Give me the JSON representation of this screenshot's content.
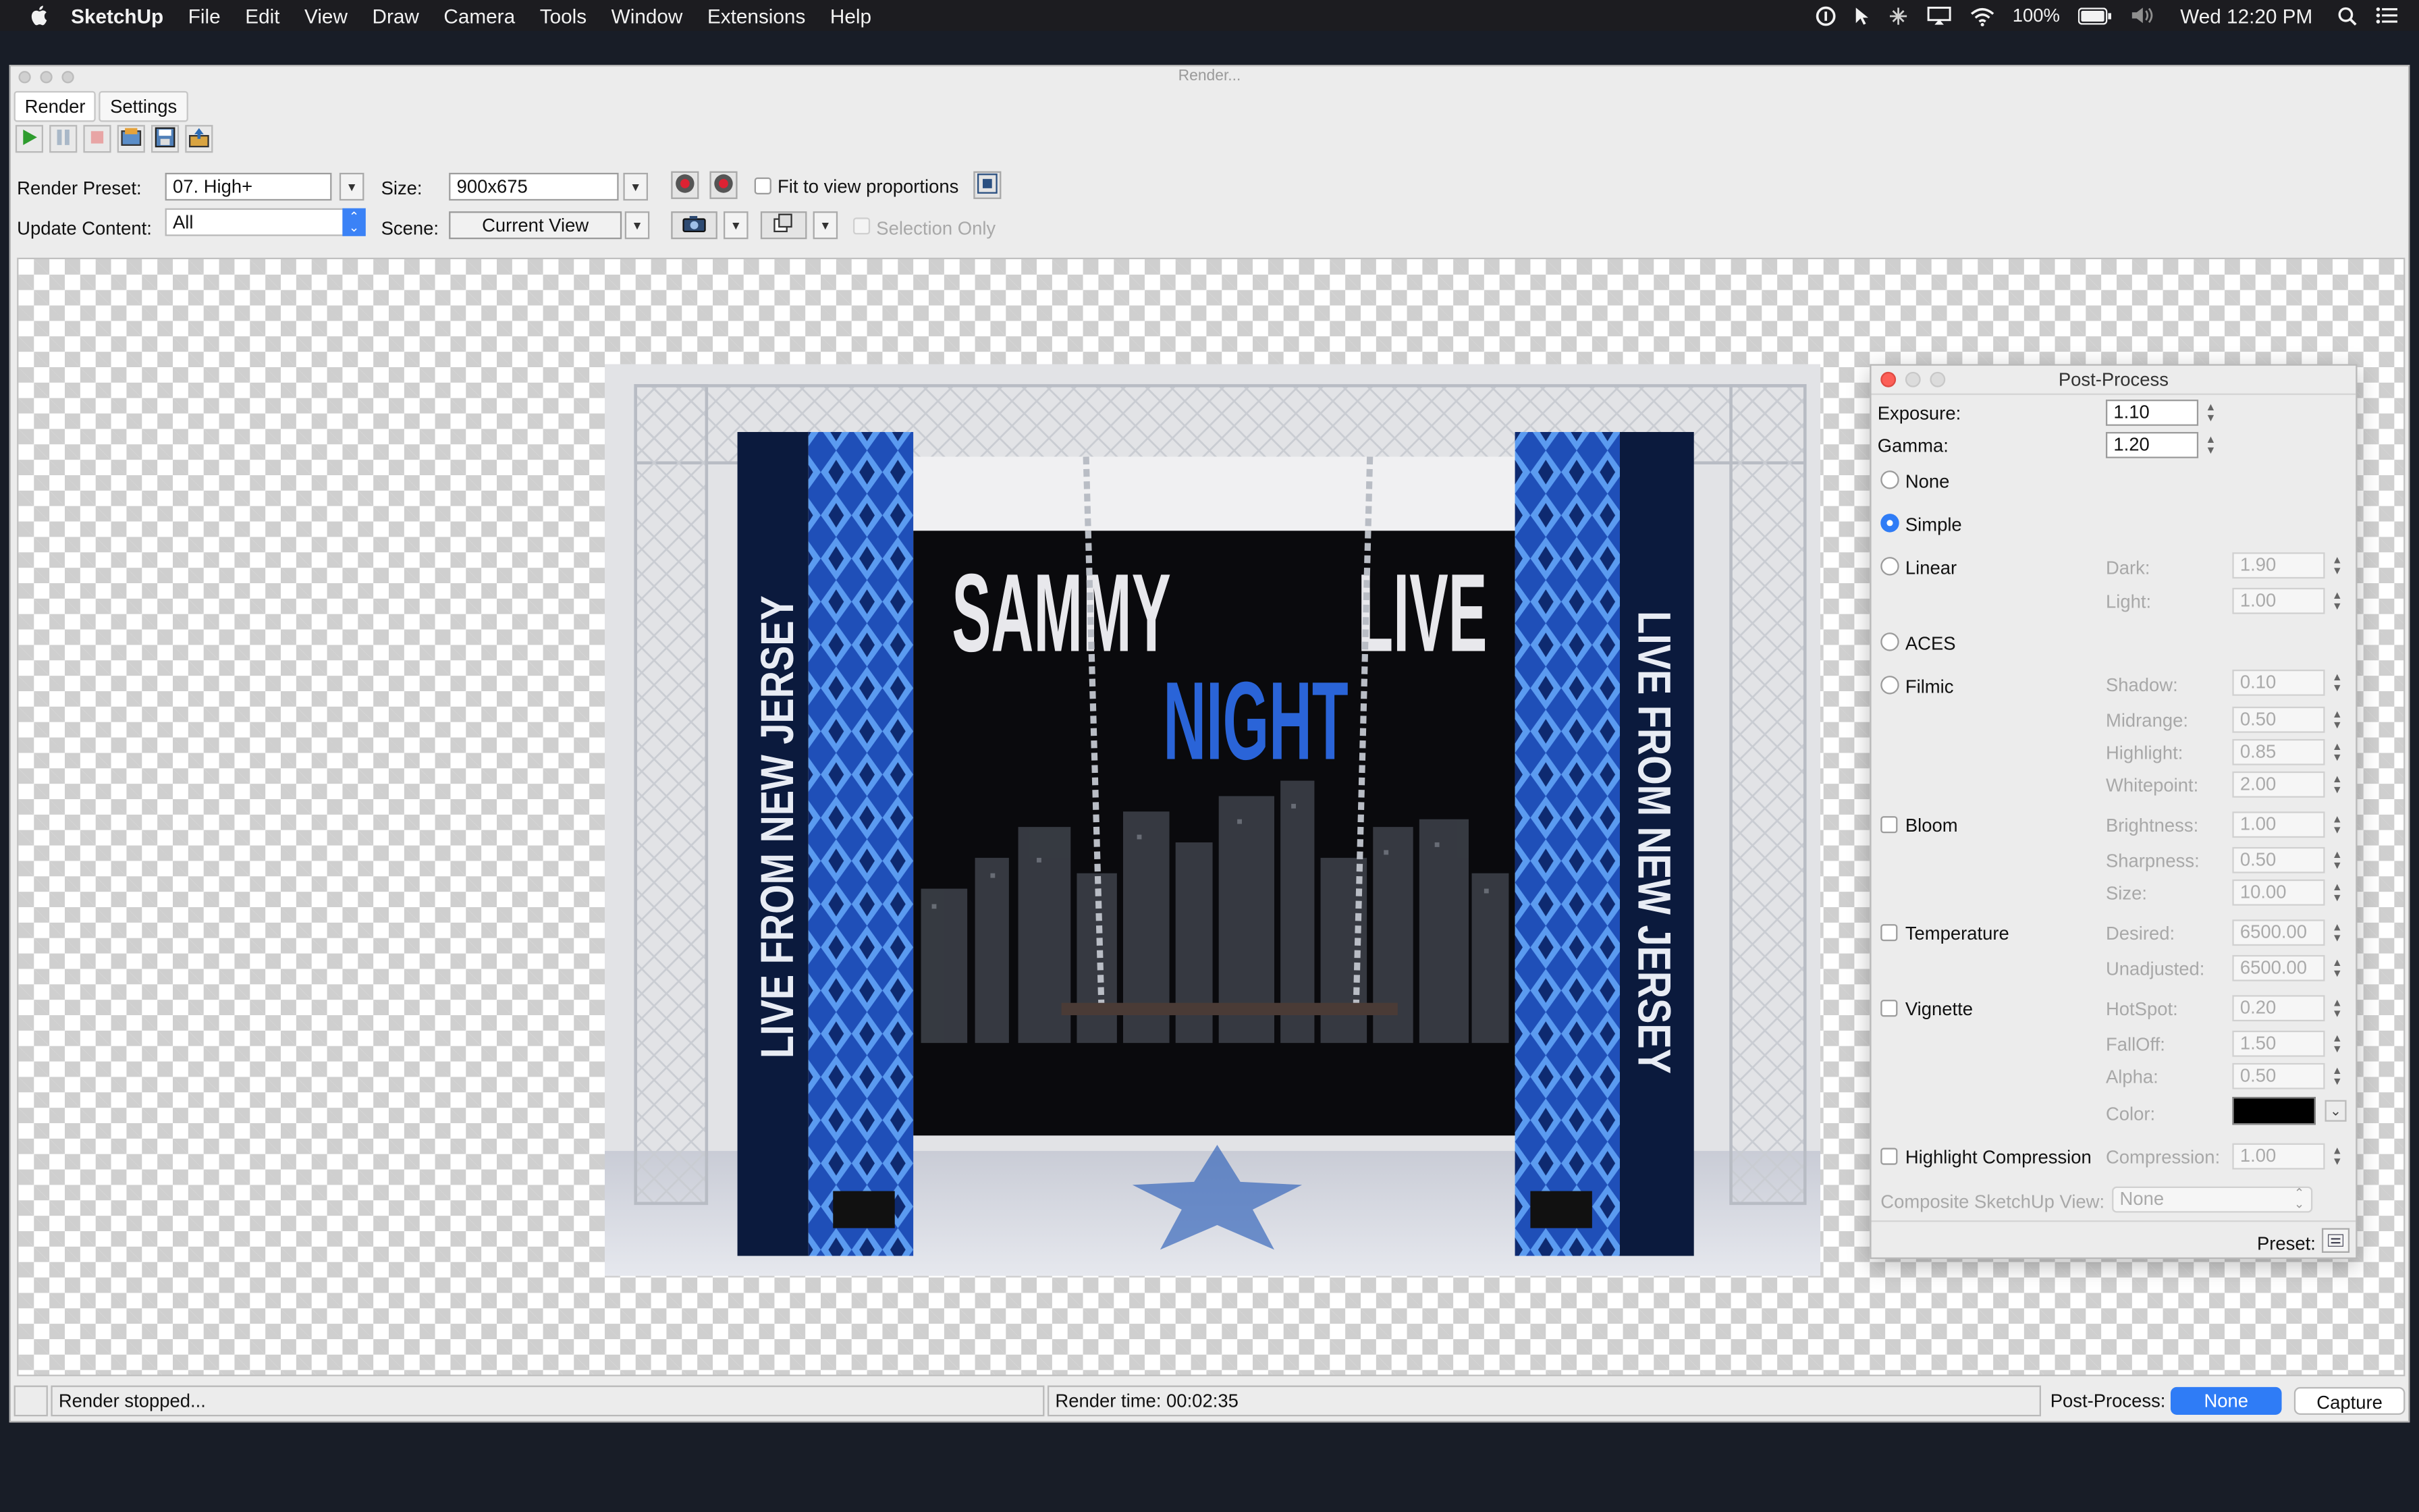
{
  "menubar": {
    "app": "SketchUp",
    "items": [
      "File",
      "Edit",
      "View",
      "Draw",
      "Camera",
      "Tools",
      "Window",
      "Extensions",
      "Help"
    ],
    "battery": "100%",
    "clock": "Wed 12:20 PM"
  },
  "window": {
    "title": "Render...",
    "tabs": [
      "Render",
      "Settings"
    ]
  },
  "controls": {
    "render_preset_label": "Render Preset:",
    "render_preset_value": "07. High+",
    "size_label": "Size:",
    "size_value": "900x675",
    "fit_label": "Fit to view proportions",
    "update_content_label": "Update Content:",
    "update_content_value": "All",
    "scene_label": "Scene:",
    "scene_value": "Current View",
    "selection_only_label": "Selection Only"
  },
  "render_image": {
    "text_sammy": "SAMMY",
    "text_live": "LIVE",
    "text_night": "NIGHT",
    "banner_left": "LIVE FROM NEW JERSEY",
    "banner_right": "LIVE FROM NEW JERSEY"
  },
  "post_process": {
    "title": "Post-Process",
    "exposure_label": "Exposure:",
    "exposure_value": "1.10",
    "gamma_label": "Gamma:",
    "gamma_value": "1.20",
    "tonemap_options": [
      "None",
      "Simple",
      "Linear",
      "ACES",
      "Filmic"
    ],
    "selected_tonemap": "Simple",
    "linear": {
      "dark_label": "Dark:",
      "dark": "1.90",
      "light_label": "Light:",
      "light": "1.00"
    },
    "filmic": {
      "shadow_label": "Shadow:",
      "shadow": "0.10",
      "midrange_label": "Midrange:",
      "midrange": "0.50",
      "highlight_label": "Highlight:",
      "highlight": "0.85",
      "whitepoint_label": "Whitepoint:",
      "whitepoint": "2.00"
    },
    "bloom": {
      "label": "Bloom",
      "brightness_label": "Brightness:",
      "brightness": "1.00",
      "sharpness_label": "Sharpness:",
      "sharpness": "0.50",
      "size_label": "Size:",
      "size": "10.00"
    },
    "temperature": {
      "label": "Temperature",
      "desired_label": "Desired:",
      "desired": "6500.00",
      "unadjusted_label": "Unadjusted:",
      "unadjusted": "6500.00"
    },
    "vignette": {
      "label": "Vignette",
      "hotspot_label": "HotSpot:",
      "hotspot": "0.20",
      "falloff_label": "FallOff:",
      "falloff": "1.50",
      "alpha_label": "Alpha:",
      "alpha": "0.50",
      "color_label": "Color:",
      "color": "#000000"
    },
    "highlight_compression": {
      "label": "Highlight Compression",
      "compression_label": "Compression:",
      "compression": "1.00"
    },
    "composite_label": "Composite SketchUp View:",
    "composite_value": "None",
    "preset_label": "Preset:"
  },
  "status": {
    "message": "Render stopped...",
    "render_time": "Render time: 00:02:35",
    "post_process_label": "Post-Process:",
    "none_button": "None",
    "capture_button": "Capture"
  },
  "colors": {
    "accent": "#2f7cf6",
    "menubar": "#1c1c20",
    "stage_blue": "#2a64d8"
  }
}
